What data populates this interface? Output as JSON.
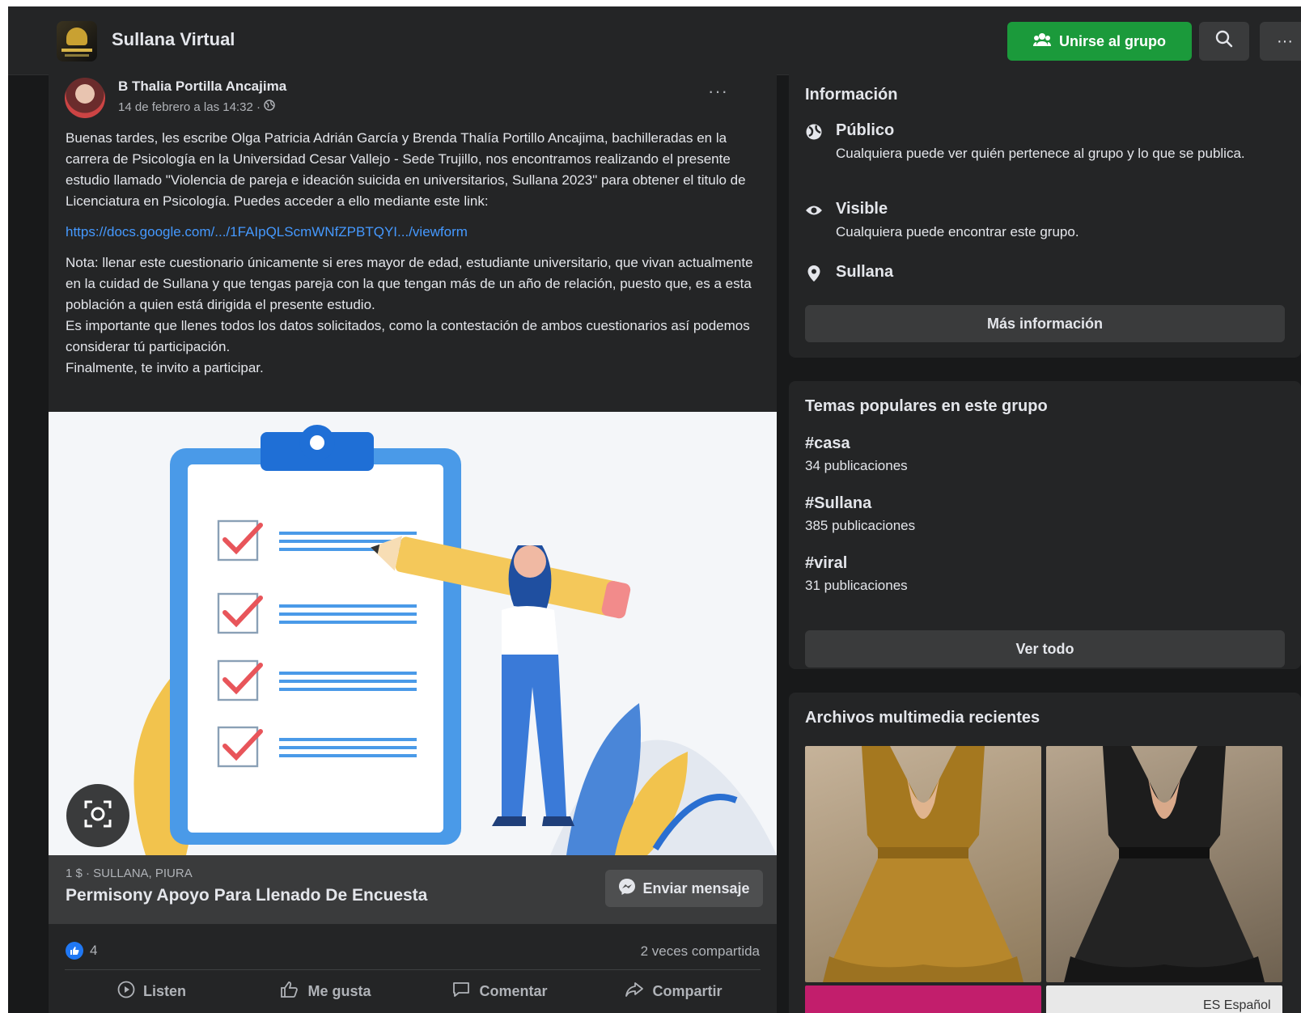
{
  "header": {
    "group_name": "Sullana Virtual",
    "join_label": "Unirse al grupo",
    "more_label": "···"
  },
  "post": {
    "author": "B Thalia Portilla Ancajima",
    "timestamp": "14 de febrero a las 14:32 ·",
    "more_label": "···",
    "paragraph1": "Buenas tardes, les escribe Olga Patricia Adrián García y Brenda Thalía Portillo Ancajima, bachilleradas en la carrera de Psicología en la Universidad Cesar Vallejo - Sede Trujillo, nos encontramos realizando el presente estudio llamado \"Violencia de pareja e ideación suicida en universitarios, Sullana 2023\" para obtener el titulo de Licenciatura en Psicología. Puedes acceder a ello mediante este link:",
    "link": "https://docs.google.com/.../1FAIpQLScmWNfZPBTQYI.../viewform",
    "note1": "Nota: llenar este cuestionario únicamente si eres mayor de edad, estudiante universitario, que vivan actualmente en la cuidad de Sullana y que tengas pareja con la que tengan más de un año de relación, puesto que, es a esta población a quien está dirigida el presente estudio.",
    "note2": "Es importante que llenes todos los datos solicitados, como la contestación de ambos cuestionarios así podemos considerar tú participación.",
    "note3": "Finalmente, te invito a participar.",
    "listing": {
      "meta": "1 $ · SULLANA, PIURA",
      "title": "Permisony Apoyo Para Llenado De Encuesta",
      "message_label": "Enviar mensaje"
    },
    "likes": "4",
    "shares": "2 veces compartida",
    "actions": {
      "listen": "Listen",
      "like": "Me gusta",
      "comment": "Comentar",
      "share": "Compartir"
    }
  },
  "sidebar": {
    "info": {
      "title": "Información",
      "items": [
        {
          "title": "Público",
          "desc": "Cualquiera puede ver quién pertenece al grupo y lo que se publica.",
          "icon": "globe-icon"
        },
        {
          "title": "Visible",
          "desc": "Cualquiera puede encontrar este grupo.",
          "icon": "eye-icon"
        },
        {
          "title": "Sullana",
          "desc": "",
          "icon": "location-pin-icon"
        }
      ],
      "more_label": "Más información"
    },
    "topics": {
      "title": "Temas populares en este grupo",
      "items": [
        {
          "tag": "#casa",
          "count": "34 publicaciones"
        },
        {
          "tag": "#Sullana",
          "count": "385 publicaciones"
        },
        {
          "tag": "#viral",
          "count": "31 publicaciones"
        }
      ],
      "see_all_label": "Ver todo"
    },
    "media": {
      "title": "Archivos multimedia recientes",
      "lang_label": "ES Español"
    }
  },
  "colors": {
    "background": "#18191a",
    "surface": "#242526",
    "join_green": "#1b9a3b",
    "link_blue": "#4599ff",
    "like_blue": "#2078f4"
  }
}
